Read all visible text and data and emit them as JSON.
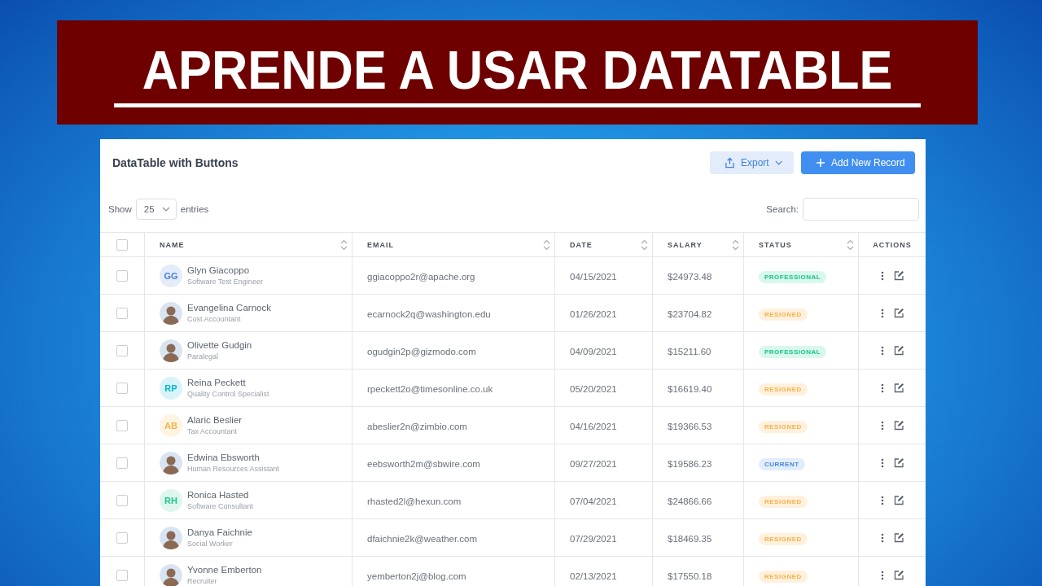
{
  "banner": {
    "title": "APRENDE A USAR DATATABLE"
  },
  "card": {
    "title": "DataTable with Buttons",
    "export_button": "Export",
    "add_button": "Add New Record"
  },
  "length": {
    "before": "Show",
    "value": "25",
    "after": "entries"
  },
  "search": {
    "label": "Search:"
  },
  "table": {
    "select_all_checked": false,
    "columns": [
      {
        "label": "NAME",
        "sortable": true
      },
      {
        "label": "EMAIL",
        "sortable": true
      },
      {
        "label": "DATE",
        "sortable": true
      },
      {
        "label": "SALARY",
        "sortable": true
      },
      {
        "label": "STATUS",
        "sortable": true
      },
      {
        "label": "ACTIONS",
        "sortable": false
      }
    ],
    "rows": [
      {
        "checked": false,
        "avatar": {
          "kind": "initials",
          "text": "GG",
          "color": "#4a7fd4"
        },
        "name": "Glyn Giacoppo",
        "role": "Software Test Engineer",
        "email": "ggiacoppo2r@apache.org",
        "date": "04/15/2021",
        "salary": "$24973.48",
        "status": {
          "label": "PROFESSIONAL",
          "kind": "professional"
        }
      },
      {
        "checked": false,
        "avatar": {
          "kind": "photo"
        },
        "name": "Evangelina Carnock",
        "role": "Cost Accountant",
        "email": "ecarnock2q@washington.edu",
        "date": "01/26/2021",
        "salary": "$23704.82",
        "status": {
          "label": "RESIGNED",
          "kind": "resigned"
        }
      },
      {
        "checked": false,
        "avatar": {
          "kind": "photo"
        },
        "name": "Olivette Gudgin",
        "role": "Paralegal",
        "email": "ogudgin2p@gizmodo.com",
        "date": "04/09/2021",
        "salary": "$15211.60",
        "status": {
          "label": "PROFESSIONAL",
          "kind": "professional"
        }
      },
      {
        "checked": false,
        "avatar": {
          "kind": "initials",
          "text": "RP",
          "color": "#00b8d0"
        },
        "name": "Reina Peckett",
        "role": "Quality Control Specialist",
        "email": "rpeckett2o@timesonline.co.uk",
        "date": "05/20/2021",
        "salary": "$16619.40",
        "status": {
          "label": "RESIGNED",
          "kind": "resigned"
        }
      },
      {
        "checked": false,
        "avatar": {
          "kind": "initials",
          "text": "AB",
          "color": "#f5b446"
        },
        "name": "Alaric Beslier",
        "role": "Tax Accountant",
        "email": "abeslier2n@zimbio.com",
        "date": "04/16/2021",
        "salary": "$19366.53",
        "status": {
          "label": "RESIGNED",
          "kind": "resigned"
        }
      },
      {
        "checked": false,
        "avatar": {
          "kind": "photo"
        },
        "name": "Edwina Ebsworth",
        "role": "Human Resources Assistant",
        "email": "eebsworth2m@sbwire.com",
        "date": "09/27/2021",
        "salary": "$19586.23",
        "status": {
          "label": "CURRENT",
          "kind": "current"
        }
      },
      {
        "checked": false,
        "avatar": {
          "kind": "initials",
          "text": "RH",
          "color": "#1fc48a"
        },
        "name": "Ronica Hasted",
        "role": "Software Consultant",
        "email": "rhasted2l@hexun.com",
        "date": "07/04/2021",
        "salary": "$24866.66",
        "status": {
          "label": "RESIGNED",
          "kind": "resigned"
        }
      },
      {
        "checked": false,
        "avatar": {
          "kind": "photo"
        },
        "name": "Danya Faichnie",
        "role": "Social Worker",
        "email": "dfaichnie2k@weather.com",
        "date": "07/29/2021",
        "salary": "$18469.35",
        "status": {
          "label": "RESIGNED",
          "kind": "resigned"
        }
      },
      {
        "checked": false,
        "avatar": {
          "kind": "photo"
        },
        "name": "Yvonne Emberton",
        "role": "Recruiter",
        "email": "yemberton2j@blog.com",
        "date": "02/13/2021",
        "salary": "$17550.18",
        "status": {
          "label": "RESIGNED",
          "kind": "resigned"
        }
      }
    ]
  }
}
